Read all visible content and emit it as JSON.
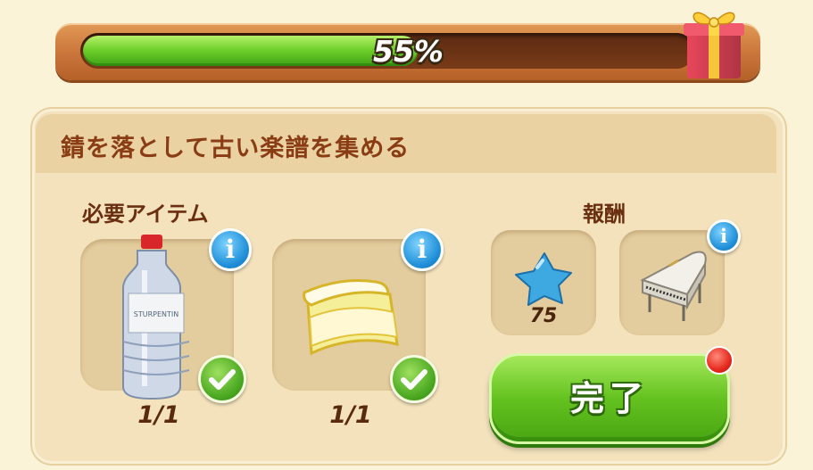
{
  "progress": {
    "value": 0.55,
    "label": "55%"
  },
  "quest": {
    "title": "錆を落として古い楽譜を集める",
    "required_label": "必要アイテム",
    "reward_label": "報酬",
    "items": [
      {
        "icon": "turpentine-bottle-icon",
        "bottle_label": "STURPENTIN",
        "count": "1/1"
      },
      {
        "icon": "cleaning-cloth-icon",
        "count": "1/1"
      }
    ],
    "rewards": [
      {
        "icon": "blue-star-icon",
        "amount": "75"
      },
      {
        "icon": "grand-piano-icon"
      }
    ],
    "complete_label": "完了"
  }
}
